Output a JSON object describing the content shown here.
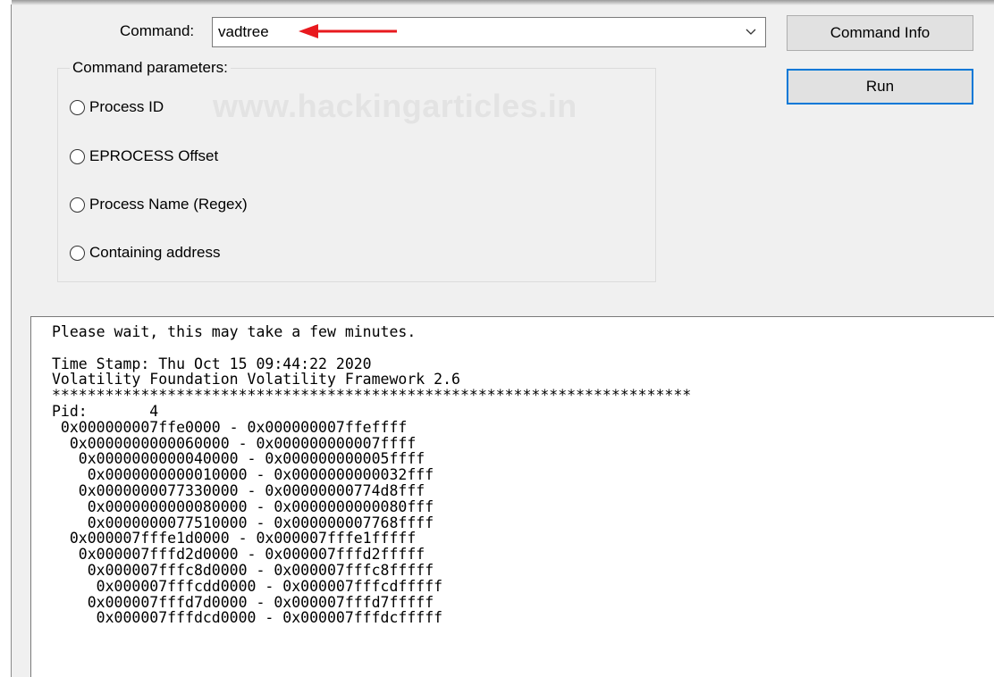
{
  "command": {
    "label": "Command:",
    "selected_value": "vadtree"
  },
  "buttons": {
    "command_info": "Command Info",
    "run": "Run"
  },
  "parameters": {
    "legend": "Command parameters:",
    "options": [
      {
        "label": "Process ID",
        "selected": false
      },
      {
        "label": "EPROCESS Offset",
        "selected": false
      },
      {
        "label": "Process Name (Regex)",
        "selected": false
      },
      {
        "label": "Containing address",
        "selected": false
      }
    ]
  },
  "watermark": "www.hackingarticles.in",
  "annotation_color": "#e8191e",
  "output": {
    "lines": [
      "Please wait, this may take a few minutes.",
      "",
      "Time Stamp: Thu Oct 15 09:44:22 2020",
      "Volatility Foundation Volatility Framework 2.6",
      "************************************************************************",
      "Pid:       4",
      " 0x000000007ffe0000 - 0x000000007ffeffff",
      "  0x0000000000060000 - 0x000000000007ffff",
      "   0x0000000000040000 - 0x000000000005ffff",
      "    0x0000000000010000 - 0x0000000000032fff",
      "   0x0000000077330000 - 0x00000000774d8fff",
      "    0x0000000000080000 - 0x0000000000080fff",
      "    0x0000000077510000 - 0x000000007768ffff",
      "  0x000007fffe1d0000 - 0x000007fffe1fffff",
      "   0x000007fffd2d0000 - 0x000007fffd2fffff",
      "    0x000007fffc8d0000 - 0x000007fffc8fffff",
      "     0x000007fffcdd0000 - 0x000007fffcdfffff",
      "    0x000007fffd7d0000 - 0x000007fffd7fffff",
      "     0x000007fffdcd0000 - 0x000007fffdcfffff"
    ]
  }
}
